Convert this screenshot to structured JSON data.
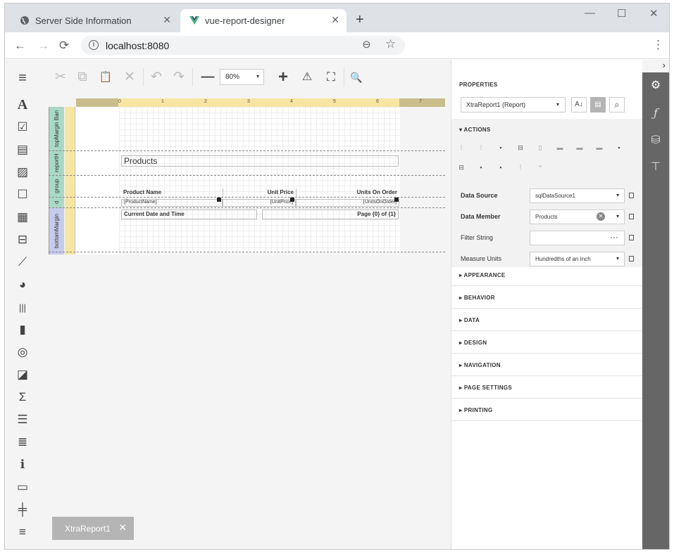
{
  "browser": {
    "tabs": [
      {
        "title": "Server Side Information",
        "icon": "globe-icon"
      },
      {
        "title": "vue-report-designer",
        "icon": "vue-logo-icon"
      }
    ],
    "close_glyph": "✕",
    "new_tab_glyph": "+",
    "url": "localhost:8080",
    "controls": {
      "minimize": "—",
      "maximize": "☐",
      "close": "✕"
    },
    "nav": {
      "back": "←",
      "forward": "→",
      "reload": "⟳",
      "menu": "⋮",
      "zoom": "⊖",
      "star": "☆",
      "info": "i"
    }
  },
  "toolbar": {
    "zoom_value": "80%",
    "dropdown_glyph": "▾",
    "buttons": {
      "cut": "✂",
      "copy": "⧉",
      "paste": "📋",
      "delete": "✕",
      "undo": "↶",
      "redo": "↷",
      "zoom_out": "—",
      "zoom_in": "+",
      "validate": "⚠",
      "fullscreen": "⛶",
      "preview": "🔍"
    }
  },
  "toolbox": [
    {
      "name": "label-tool-icon",
      "glyph": "A"
    },
    {
      "name": "checkbox-tool-icon",
      "glyph": "☑"
    },
    {
      "name": "richtext-tool-icon",
      "glyph": "▤"
    },
    {
      "name": "picture-tool-icon",
      "glyph": "▨"
    },
    {
      "name": "panel-tool-icon",
      "glyph": "☐"
    },
    {
      "name": "table-tool-icon",
      "glyph": "▦"
    },
    {
      "name": "character-comb-tool-icon",
      "glyph": "⊟"
    },
    {
      "name": "line-tool-icon",
      "glyph": "⟋"
    },
    {
      "name": "shape-tool-icon",
      "glyph": "◕"
    },
    {
      "name": "barcode-tool-icon",
      "glyph": "|||"
    },
    {
      "name": "chart-tool-icon",
      "glyph": "▮"
    },
    {
      "name": "gauge-tool-icon",
      "glyph": "◎"
    },
    {
      "name": "sparkline-tool-icon",
      "glyph": "◪"
    },
    {
      "name": "summary-tool-icon",
      "glyph": "Σ"
    },
    {
      "name": "pdf-content-tool-icon",
      "glyph": "☰"
    },
    {
      "name": "table-of-contents-tool-icon",
      "glyph": "≣"
    },
    {
      "name": "page-info-tool-icon",
      "glyph": "ℹ"
    },
    {
      "name": "cross-band-box-tool-icon",
      "glyph": "▭"
    },
    {
      "name": "cross-band-line-tool-icon",
      "glyph": "╪"
    },
    {
      "name": "page-break-tool-icon",
      "glyph": "≡"
    }
  ],
  "bands": {
    "top_margin": "topMargin Ban",
    "report_header": "reportH",
    "group_header": "group",
    "detail": "d",
    "bottom_margin": "bottomMargin"
  },
  "ruler_labels": [
    "0",
    "1",
    "2",
    "3",
    "4",
    "5",
    "6",
    "7"
  ],
  "report": {
    "title": "Products",
    "headers": {
      "product_name": "Product Name",
      "unit_price": "Unit Price",
      "units_on_order": "Units On Order"
    },
    "detail": {
      "product_name": "[ProductName]",
      "unit_price": "[UnitPrice]",
      "units_on_order": "[UnitsOnOrder]"
    },
    "footer": {
      "date_time": "Current Date and Time",
      "page": "Page {0} of {1}"
    }
  },
  "document_tab": {
    "label": "XtraReport1",
    "close": "✕"
  },
  "properties": {
    "title": "PROPERTIES",
    "object": "XtraReport1 (Report)",
    "sort_glyph": "A↓",
    "category_glyph": "▤",
    "search_glyph": "⌕",
    "actions_header": "▾ ACTIONS",
    "rows": [
      {
        "label": "Data Source",
        "value": "sqlDataSource1",
        "bold": true
      },
      {
        "label": "Data Member",
        "value": "Products",
        "bold": true
      },
      {
        "label": "Filter String",
        "value": "",
        "bold": false
      },
      {
        "label": "Measure Units",
        "value": "Hundredths of an Inch",
        "bold": false
      }
    ],
    "clear_glyph": "✕",
    "ellipsis_glyph": "···",
    "groups": [
      "▸ APPEARANCE",
      "▸ BEHAVIOR",
      "▸ DATA",
      "▸ DESIGN",
      "▸ NAVIGATION",
      "▸ PAGE SETTINGS",
      "▸ PRINTING"
    ]
  },
  "sidebar": {
    "collapse": "›",
    "icons": [
      {
        "name": "properties-gear-icon",
        "glyph": "⚙"
      },
      {
        "name": "expressions-f-icon",
        "glyph": "ƒ"
      },
      {
        "name": "field-list-database-icon",
        "glyph": "⛁"
      },
      {
        "name": "report-explorer-tree-icon",
        "glyph": "⊤"
      }
    ]
  }
}
